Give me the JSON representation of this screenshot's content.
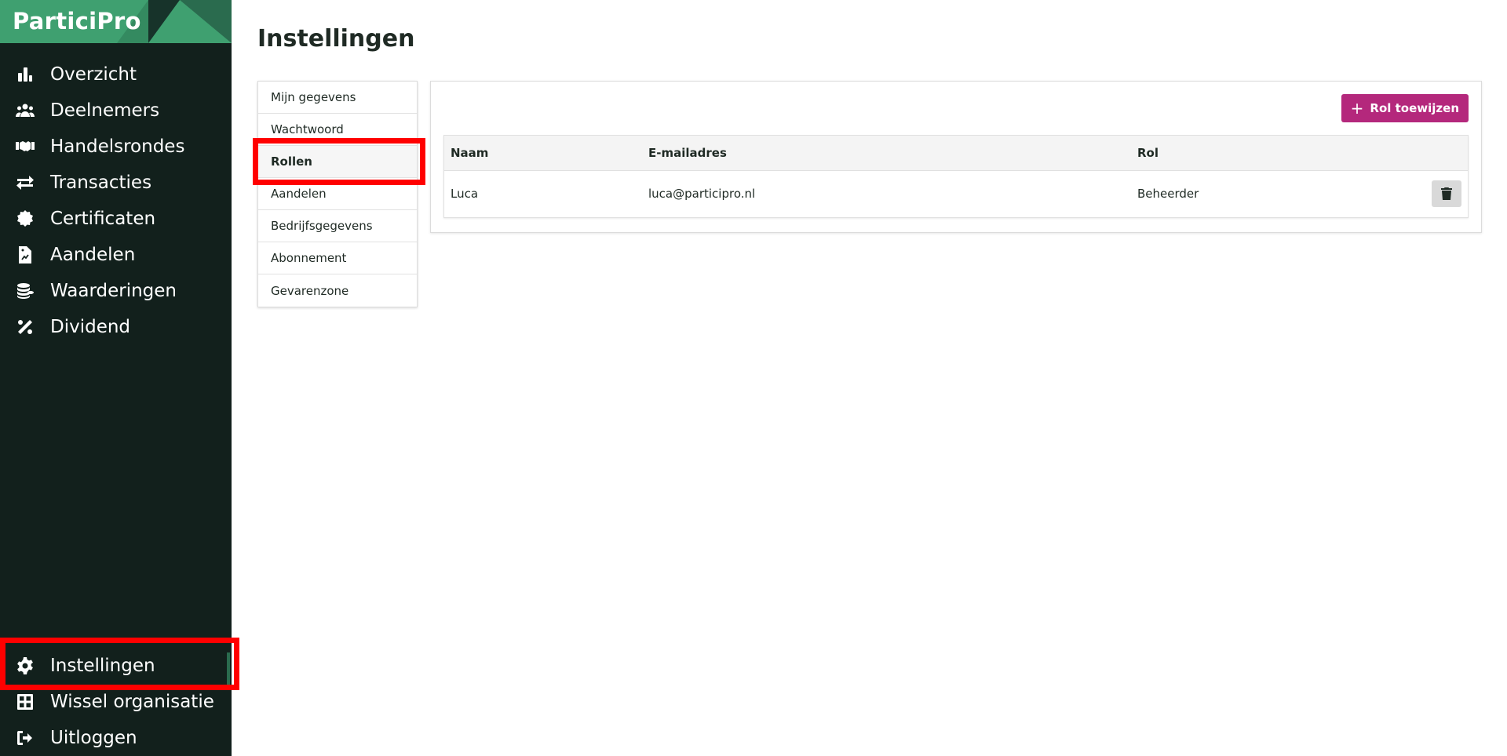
{
  "app": {
    "name": "ParticiPro"
  },
  "sidebar": {
    "items": [
      {
        "label": "Overzicht",
        "icon": "bar-chart-icon"
      },
      {
        "label": "Deelnemers",
        "icon": "users-icon"
      },
      {
        "label": "Handelsrondes",
        "icon": "handshake-icon"
      },
      {
        "label": "Transacties",
        "icon": "exchange-icon"
      },
      {
        "label": "Certificaten",
        "icon": "certificate-icon"
      },
      {
        "label": "Aandelen",
        "icon": "file-chart-icon"
      },
      {
        "label": "Waarderingen",
        "icon": "coins-icon"
      },
      {
        "label": "Dividend",
        "icon": "percent-icon"
      }
    ],
    "bottom_items": [
      {
        "label": "Instellingen",
        "icon": "gear-icon",
        "active": true
      },
      {
        "label": "Wissel organisatie",
        "icon": "grid-icon"
      },
      {
        "label": "Uitloggen",
        "icon": "logout-icon"
      }
    ]
  },
  "page": {
    "title": "Instellingen"
  },
  "settings_menu": {
    "items": [
      {
        "label": "Mijn gegevens"
      },
      {
        "label": "Wachtwoord"
      },
      {
        "label": "Rollen",
        "active": true
      },
      {
        "label": "Aandelen"
      },
      {
        "label": "Bedrijfsgegevens"
      },
      {
        "label": "Abonnement"
      },
      {
        "label": "Gevarenzone"
      }
    ]
  },
  "roles": {
    "assign_button": "Rol toewijzen",
    "columns": [
      "Naam",
      "E-mailadres",
      "Rol"
    ],
    "rows": [
      {
        "name": "Luca",
        "email": "luca@participro.nl",
        "role": "Beheerder"
      }
    ]
  },
  "colors": {
    "sidebar_bg": "#12201c",
    "brand_green": "#3fa070",
    "accent_magenta": "#b4287c",
    "highlight_red": "#ff0000"
  }
}
